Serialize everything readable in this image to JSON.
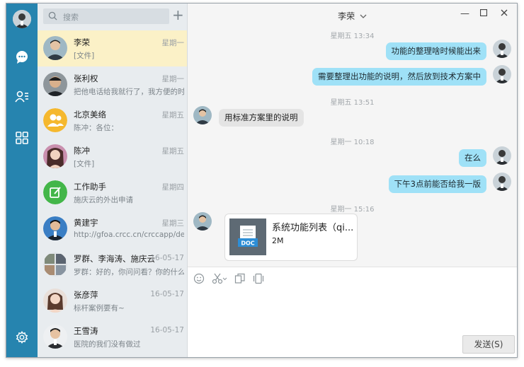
{
  "rail": {
    "nav": [
      "chat-icon",
      "contacts-icon",
      "apps-icon",
      "settings-icon"
    ]
  },
  "search": {
    "placeholder": "搜索"
  },
  "conversations": [
    {
      "name": "李荣",
      "time": "星期一",
      "preview": "[文件]",
      "selected": true
    },
    {
      "name": "张利权",
      "time": "星期一",
      "preview": "把他电话给我就行了，我方便的时"
    },
    {
      "name": "北京美络",
      "time": "星期五",
      "preview": "陈冲：各位："
    },
    {
      "name": "陈冲",
      "time": "星期五",
      "preview": "[文件]"
    },
    {
      "name": "工作助手",
      "time": "星期四",
      "preview": "施庆云的外出申请"
    },
    {
      "name": "黄建宇",
      "time": "星期三",
      "preview": "http://gfoa.crcc.cn/crccapp/dep"
    },
    {
      "name": "罗群、李海涛、施庆云",
      "time": "16-05-17",
      "preview": "罗群：好的，你问问看？你的什么"
    },
    {
      "name": "张彦萍",
      "time": "16-05-17",
      "preview": "标杆案例要有~"
    },
    {
      "name": "王雪涛",
      "time": "16-05-17",
      "preview": "医院的我们没有做过"
    }
  ],
  "chat": {
    "title": "李荣",
    "stamps": [
      "星期五 13:34",
      "星期五 13:51",
      "星期一 10:18",
      "星期一 15:16"
    ],
    "messages": [
      {
        "text": "功能的整理啥时候能出来",
        "from": "me"
      },
      {
        "text": "需要整理出功能的说明，然后放到技术方案中",
        "from": "me"
      },
      {
        "text": "用标准方案里的说明",
        "from": "other"
      },
      {
        "text": "在么",
        "from": "me"
      },
      {
        "text": "下午3点前能否给我一版",
        "from": "me"
      }
    ],
    "file": {
      "name": "系统功能列表（qi...",
      "size": "2M",
      "badge": "DOC"
    }
  },
  "composer": {
    "send_label": "发送(S)"
  }
}
